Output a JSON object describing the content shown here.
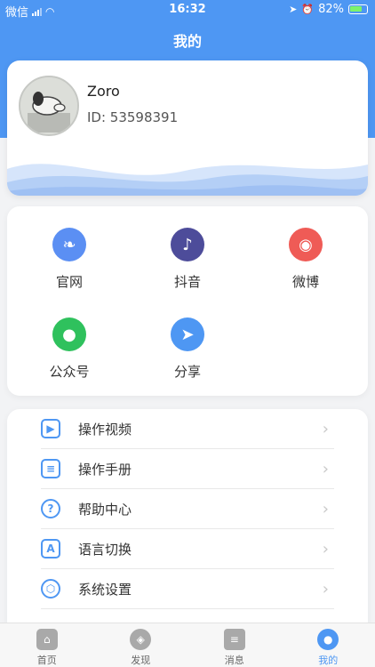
{
  "status_bar": {
    "carrier": "微信",
    "time": "16:32",
    "battery": "82%"
  },
  "header": {
    "title": "我的"
  },
  "profile": {
    "name": "Zoro",
    "id_text": "ID: 53598391"
  },
  "links": [
    {
      "label": "官网",
      "icon": "leaf-icon",
      "color": "#5b8ff3"
    },
    {
      "label": "抖音",
      "icon": "tiktok-icon",
      "color": "#4d4c9a"
    },
    {
      "label": "微博",
      "icon": "weibo-icon",
      "color": "#ef5b56"
    },
    {
      "label": "公众号",
      "icon": "wechat-icon",
      "color": "#2fc15d"
    },
    {
      "label": "分享",
      "icon": "share-icon",
      "color": "#4e97f3"
    }
  ],
  "menu": [
    {
      "label": "操作视频",
      "icon": "video-icon"
    },
    {
      "label": "操作手册",
      "icon": "manual-icon"
    },
    {
      "label": "帮助中心",
      "icon": "help-icon"
    },
    {
      "label": "语言切换",
      "icon": "language-icon"
    },
    {
      "label": "系统设置",
      "icon": "settings-icon"
    }
  ],
  "tabbar": [
    {
      "label": "首页",
      "icon": "home-icon"
    },
    {
      "label": "发现",
      "icon": "compass-icon"
    },
    {
      "label": "消息",
      "icon": "message-icon"
    },
    {
      "label": "我的",
      "icon": "user-icon",
      "active": true
    }
  ]
}
